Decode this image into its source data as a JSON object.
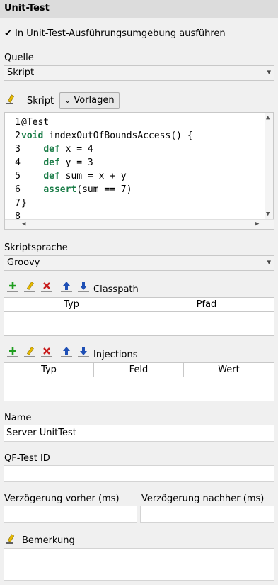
{
  "header": {
    "title": "Unit-Test"
  },
  "run_in_env": {
    "checked": true,
    "label": "In Unit-Test-Ausführungsumgebung ausführen"
  },
  "source": {
    "label": "Quelle",
    "value": "Skript"
  },
  "script_toolbar": {
    "label": "Skript",
    "templates_button": "Vorlagen"
  },
  "editor": {
    "line_numbers": [
      "1",
      "2",
      "3",
      "4",
      "5",
      "6",
      "7",
      "8"
    ],
    "lines": [
      [
        {
          "t": "@Test",
          "k": false
        }
      ],
      [
        {
          "t": "void",
          "k": true
        },
        {
          "t": " indexOutOfBoundsAccess() {",
          "k": false
        }
      ],
      [
        {
          "t": "    ",
          "k": false
        },
        {
          "t": "def",
          "k": true
        },
        {
          "t": " x = 4",
          "k": false
        }
      ],
      [
        {
          "t": "    ",
          "k": false
        },
        {
          "t": "def",
          "k": true
        },
        {
          "t": " y = 3",
          "k": false
        }
      ],
      [
        {
          "t": "    ",
          "k": false
        },
        {
          "t": "def",
          "k": true
        },
        {
          "t": " sum = x + y",
          "k": false
        }
      ],
      [
        {
          "t": "    ",
          "k": false
        },
        {
          "t": "assert",
          "k": true
        },
        {
          "t": "(sum == 7)",
          "k": false
        }
      ],
      [
        {
          "t": "}",
          "k": false
        }
      ],
      [
        {
          "t": "",
          "k": false
        }
      ]
    ]
  },
  "script_language": {
    "label": "Skriptsprache",
    "value": "Groovy"
  },
  "classpath": {
    "label": "Classpath",
    "columns": [
      "Typ",
      "Pfad"
    ]
  },
  "injections": {
    "label": "Injections",
    "columns": [
      "Typ",
      "Feld",
      "Wert"
    ]
  },
  "name": {
    "label": "Name",
    "value": "Server UnitTest"
  },
  "qftest_id": {
    "label": "QF-Test ID",
    "value": ""
  },
  "delay_before": {
    "label": "Verzögerung vorher (ms)",
    "value": ""
  },
  "delay_after": {
    "label": "Verzögerung nachher (ms)",
    "value": ""
  },
  "remark": {
    "label": "Bemerkung",
    "value": ""
  },
  "colors": {
    "keyword": "#1b7d48",
    "add": "#1f9e1f",
    "delete": "#c81e1e",
    "move": "#1e4fb5",
    "pencil": "#e5b800"
  }
}
